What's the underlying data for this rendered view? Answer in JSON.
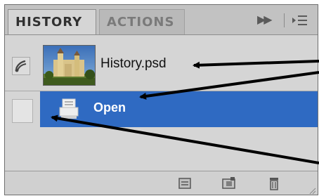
{
  "tabs": [
    {
      "label": "HISTORY",
      "active": true
    },
    {
      "label": "ACTIONS",
      "active": false
    }
  ],
  "panel_controls": {
    "expand_icon": "double-right-arrow-icon",
    "menu_icon": "panel-menu-icon"
  },
  "snapshot": {
    "name": "History.psd",
    "source_icon": "history-brush-icon",
    "thumbnail_icon": "castle-photo-thumbnail"
  },
  "history_states": [
    {
      "label": "Open",
      "icon": "open-document-icon",
      "selected": true
    }
  ],
  "bottom_bar": {
    "buttons": [
      {
        "name": "new-document-from-state-icon"
      },
      {
        "name": "new-snapshot-icon"
      },
      {
        "name": "trash-icon"
      }
    ]
  },
  "colors": {
    "selection": "#2f6ac2",
    "panel_bg": "#d5d5d5",
    "annotation_arrow": "#000000"
  }
}
